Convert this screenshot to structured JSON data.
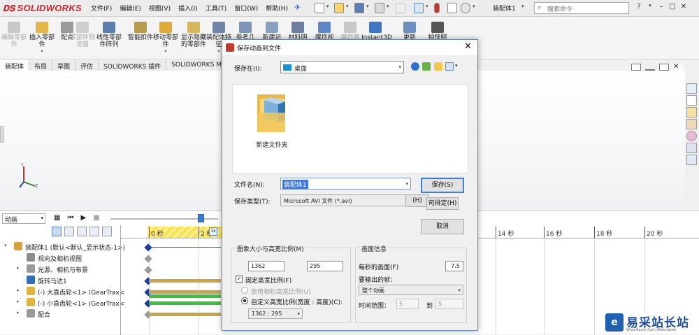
{
  "app": {
    "brand_ds": "𝐃𝐒",
    "brand": "SOLIDWORKS",
    "doc_title": "装配体1",
    "search_placeholder": "搜索命令"
  },
  "menu": [
    "文件(F)",
    "编辑(E)",
    "视图(V)",
    "插入(I)",
    "工具(T)",
    "窗口(W)",
    "帮助(H)"
  ],
  "window_controls": [
    "?",
    "–",
    "□",
    "✕"
  ],
  "ribbon": [
    {
      "label": "编辑零部件",
      "disabled": true,
      "icon": "edit-component-icon",
      "color": "#c9c9c9"
    },
    {
      "label": "插入零部件",
      "disabled": false,
      "icon": "insert-component-icon",
      "color": "#e3b64a"
    },
    {
      "label": "配合",
      "disabled": false,
      "icon": "mate-icon",
      "color": "#9a9a9a"
    },
    {
      "label": "零部件预览窗",
      "disabled": true,
      "icon": "component-preview-icon",
      "color": "#cfcfcf"
    },
    {
      "label": "线性零部件阵列",
      "disabled": false,
      "icon": "linear-pattern-icon",
      "color": "#5c7fb0"
    },
    {
      "label": "智能扣件",
      "disabled": false,
      "icon": "smart-fastener-icon",
      "color": "#b89b4c"
    },
    {
      "label": "移动零部件",
      "disabled": false,
      "icon": "move-component-icon",
      "color": "#e0a93c"
    },
    {
      "label": "显示隐藏的零部件",
      "disabled": false,
      "icon": "show-hidden-icon",
      "color": "#d9b65a"
    },
    {
      "label": "装配体特征",
      "disabled": false,
      "icon": "assembly-feature-icon",
      "color": "#6f86a8"
    },
    {
      "label": "参考几",
      "disabled": false,
      "icon": "reference-geometry-icon",
      "color": "#7d94b8"
    },
    {
      "label": "新建运",
      "disabled": false,
      "icon": "new-motion-icon",
      "color": "#8aa0c0"
    },
    {
      "label": "材料明",
      "disabled": false,
      "icon": "bom-icon",
      "color": "#6c7f9c"
    },
    {
      "label": "爆炸视",
      "disabled": false,
      "icon": "explode-icon",
      "color": "#5c86c8"
    },
    {
      "label": "爆炸直",
      "disabled": true,
      "icon": "explode-line-icon",
      "color": "#c7c7c7"
    },
    {
      "label": "Instant3D",
      "disabled": false,
      "icon": "instant3d-icon",
      "color": "#3f77c4"
    },
    {
      "label": "更新",
      "disabled": false,
      "icon": "update-icon",
      "color": "#6c8fbf"
    },
    {
      "label": "拍快照",
      "disabled": false,
      "icon": "snapshot-icon",
      "color": "#555555"
    }
  ],
  "cm_tabs": [
    "装配体",
    "布局",
    "草图",
    "评估",
    "SOLIDWORKS 插件",
    "SOLIDWORKS M"
  ],
  "motion": {
    "study": "动画",
    "tree": [
      {
        "label": "装配体1 (默认<默认_显示状态-1>)",
        "indent": 0,
        "exp": "▾",
        "icon": "assembly-icon",
        "color": "#d6a23b"
      },
      {
        "label": "视向及相机视图",
        "indent": 1,
        "exp": "",
        "icon": "camera-view-icon",
        "color": "#8c8c8c"
      },
      {
        "label": "光源、相机与布景",
        "indent": 1,
        "exp": "▸",
        "icon": "lights-cameras-icon",
        "color": "#999999"
      },
      {
        "label": "旋转马达1",
        "indent": 1,
        "exp": "",
        "icon": "rotary-motor-icon",
        "color": "#2f6fb5"
      },
      {
        "label": "(-) 大直齿轮<1> (GearTrax<",
        "indent": 1,
        "exp": "▸",
        "icon": "part-icon",
        "color": "#e3b23c"
      },
      {
        "label": "(-) 小直齿轮<1> (GearTrax<",
        "indent": 1,
        "exp": "▸",
        "icon": "part-icon",
        "color": "#e3b23c"
      },
      {
        "label": "配合",
        "indent": 1,
        "exp": "▸",
        "icon": "mates-icon",
        "color": "#9a9a9a"
      }
    ],
    "time_marker": "1x",
    "ticks": [
      "0 秒",
      "2 秒",
      "14 秒",
      "16 秒",
      "18 秒",
      "20 秒"
    ]
  },
  "dialog": {
    "title": "保存动画到文件",
    "save_in_label": "保存在(I):",
    "save_in_value": "桌面",
    "folder_item": "新建文件夹",
    "filename_label": "文件名(N):",
    "filename_value": "装配体1",
    "filetype_label": "保存类型(T):",
    "filetype_value": "Microsoft AVI 文件 (*.avi)",
    "save_button": "保存(S)",
    "help_button": "(H)",
    "schedule_button": "司排定(H)",
    "cancel_button": "取消",
    "size_group": {
      "title": "图象大小与高宽比例(M)",
      "width": "1362",
      "height": "295",
      "fixed_ratio": "固定高宽比例(F)",
      "fixed_ratio_checked": true,
      "use_camera_ratio": "使用相机高宽比例(U)",
      "custom_ratio": "自定义高宽比例(宽度 : 高度)(C):",
      "custom_ratio_value": "1362 : 295"
    },
    "info_group": {
      "title": "画面信息",
      "fps_label": "每秒的画面(F)",
      "fps_value": "7.5",
      "frames_label": "要输出的帧：",
      "frames_value": "整个动画",
      "range_label": "时间范围：",
      "range_from": "5",
      "range_to_label": "到",
      "range_to": "5"
    }
  },
  "watermark": {
    "logo": "e",
    "text": "易采站长站",
    "sub": "Www.Easck.Com Webmaster"
  },
  "colors": {
    "accent": "#3c7fd1",
    "brand": "#d2232a",
    "keyframe": "#1c3d9e",
    "gold_bar": "#c9a54a",
    "green_bar": "#3fbf3f"
  }
}
